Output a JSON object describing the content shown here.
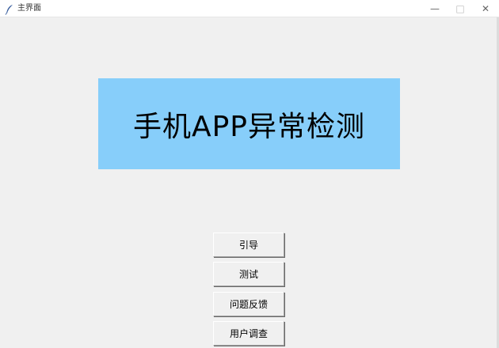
{
  "window": {
    "title": "主界面",
    "icon": "feather-icon",
    "controls": {
      "minimize": "—",
      "maximize": "□",
      "close": "✕"
    }
  },
  "banner": {
    "text": "手机APP异常检测",
    "background": "#87cefa"
  },
  "buttons": [
    {
      "label": "引导"
    },
    {
      "label": "测试"
    },
    {
      "label": "问题反馈"
    },
    {
      "label": "用户调查"
    }
  ]
}
